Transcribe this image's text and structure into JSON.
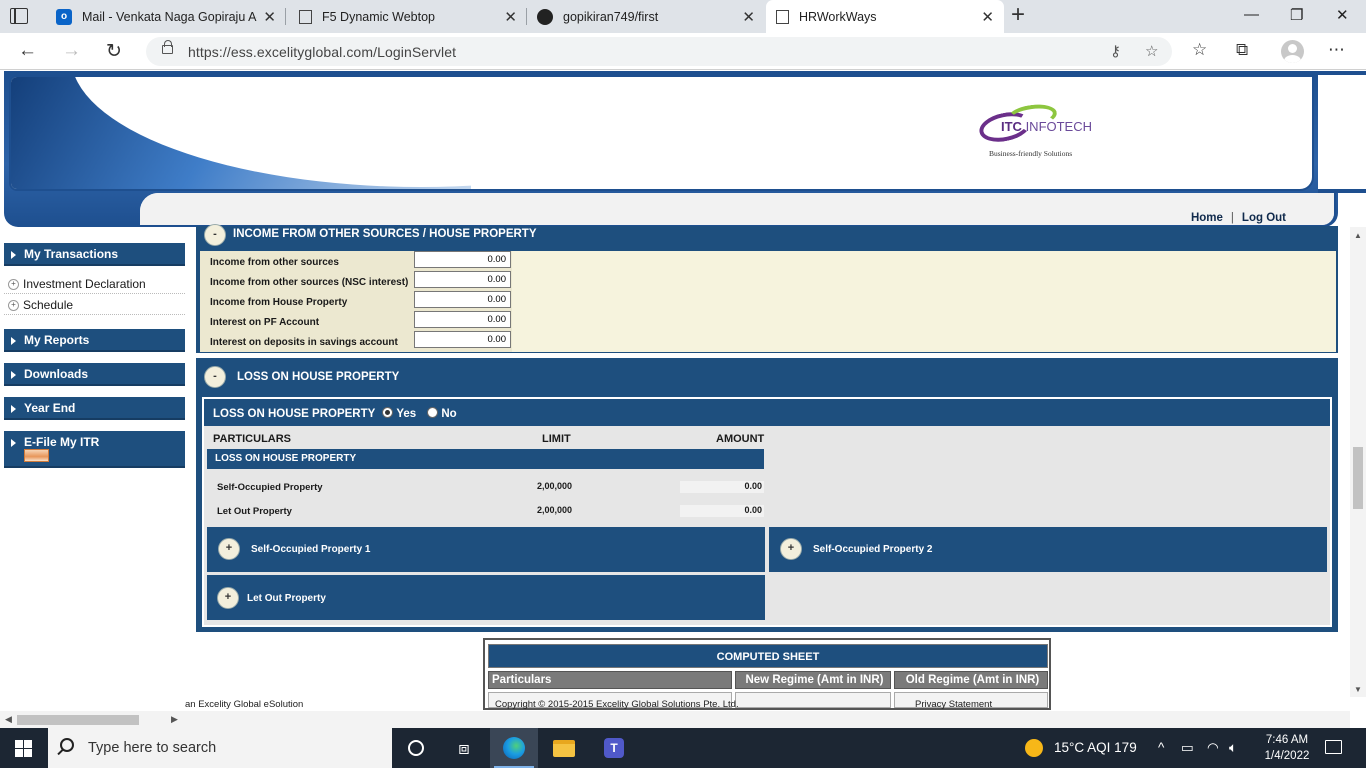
{
  "browser": {
    "tabs": [
      {
        "title": "Mail - Venkata Naga Gopiraju Ac",
        "icon": "outlook-icon"
      },
      {
        "title": "F5 Dynamic Webtop",
        "icon": "page-icon"
      },
      {
        "title": "gopikiran749/first",
        "icon": "github-icon"
      },
      {
        "title": "HRWorkWays",
        "icon": "page-icon",
        "active": true
      }
    ],
    "url": "https://ess.excelityglobal.com/LoginServlet"
  },
  "header": {
    "logo_main": "ITC",
    "logo_sub": " INFOTECH",
    "logo_tagline": "Business-friendly Solutions",
    "home_link": "Home",
    "separator": "|",
    "logout_link": "Log Out"
  },
  "sidebar": {
    "my_transactions": "My Transactions",
    "items": [
      "Investment Declaration",
      "Schedule"
    ],
    "my_reports": "My Reports",
    "downloads": "Downloads",
    "year_end": "Year End",
    "efile": "E-File My ITR"
  },
  "income_section": {
    "toggle": "-",
    "title": "INCOME FROM OTHER SOURCES / HOUSE PROPERTY",
    "rows": [
      {
        "label": "Income from other sources",
        "value": "0.00"
      },
      {
        "label": "Income from other sources (NSC interest)",
        "value": "0.00"
      },
      {
        "label": "Income from House Property",
        "value": "0.00"
      },
      {
        "label": "Interest on PF Account",
        "value": "0.00"
      },
      {
        "label": "Interest on deposits in savings account",
        "value": "0.00"
      }
    ]
  },
  "loss_section": {
    "toggle": "-",
    "title": "LOSS ON HOUSE PROPERTY",
    "question": "LOSS ON HOUSE PROPERTY",
    "yes": "Yes",
    "no": "No",
    "selected": "Yes",
    "col_particulars": "PARTICULARS",
    "col_limit": "LIMIT",
    "col_amount": "AMOUNT",
    "bar_title": "LOSS ON HOUSE PROPERTY",
    "rows": [
      {
        "label": "Self-Occupied Property",
        "limit": "2,00,000",
        "amount": "0.00"
      },
      {
        "label": "Let Out Property",
        "limit": "2,00,000",
        "amount": "0.00"
      }
    ],
    "panels": [
      {
        "toggle": "+",
        "title": "Self-Occupied Property 1"
      },
      {
        "toggle": "+",
        "title": "Self-Occupied Property 2"
      },
      {
        "toggle": "+",
        "title": "Let Out Property"
      }
    ]
  },
  "computed_sheet": {
    "title": "COMPUTED SHEET",
    "col_particulars": "Particulars",
    "col_new": "New Regime (Amt in INR)",
    "col_old": "Old Regime (Amt in INR)"
  },
  "footer": {
    "left": "an Excelity Global eSolution",
    "center": "Copyright © 2015-2015 Excelity Global Solutions Pte. Ltd.",
    "right": "Privacy Statement"
  },
  "taskbar": {
    "search_placeholder": "Type here to search",
    "weather": "15°C  AQI 179",
    "time": "7:46 AM",
    "date": "1/4/2022"
  }
}
